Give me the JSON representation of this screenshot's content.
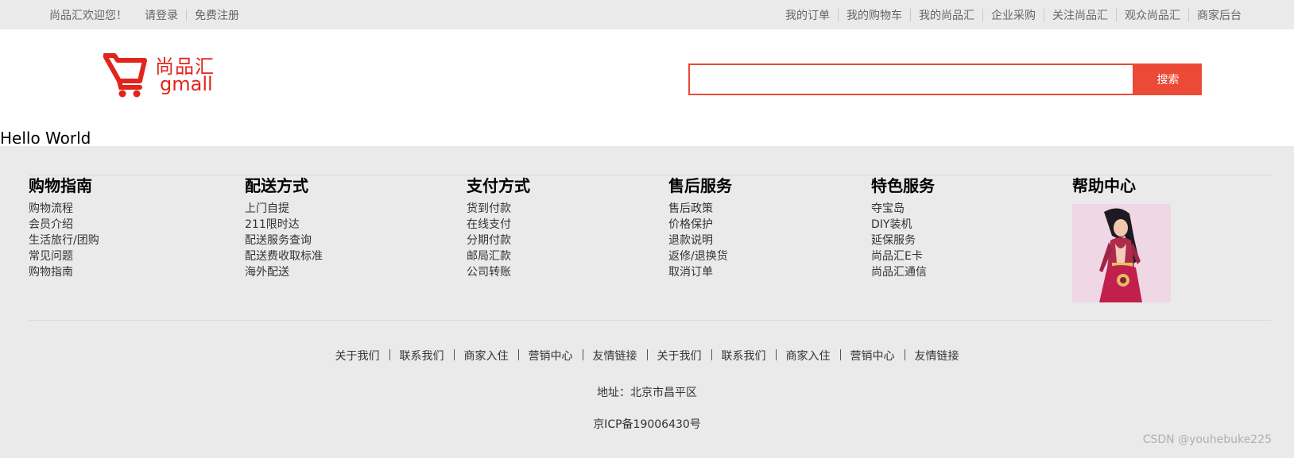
{
  "topbar": {
    "welcome": "尚品汇欢迎您！",
    "login": "请登录",
    "register": "免费注册",
    "nav": [
      "我的订单",
      "我的购物车",
      "我的尚品汇",
      "企业采购",
      "关注尚品汇",
      "观众尚品汇",
      "商家后台"
    ]
  },
  "header": {
    "logo_cn": "尚品汇",
    "logo_en": "gmall",
    "search_value": "",
    "search_button": "搜索",
    "accent": "#ea4a36"
  },
  "main": {
    "hello": "Hello World"
  },
  "footer": {
    "columns": [
      {
        "title": "购物指南",
        "items": [
          "购物流程",
          "会员介绍",
          "生活旅行/团购",
          "常见问题",
          "购物指南"
        ]
      },
      {
        "title": "配送方式",
        "items": [
          "上门自提",
          "211限时达",
          "配送服务查询",
          "配送费收取标准",
          "海外配送"
        ]
      },
      {
        "title": "支付方式",
        "items": [
          "货到付款",
          "在线支付",
          "分期付款",
          "邮局汇款",
          "公司转账"
        ]
      },
      {
        "title": "售后服务",
        "items": [
          "售后政策",
          "价格保护",
          "退款说明",
          "返修/退换货",
          "取消订单"
        ]
      },
      {
        "title": "特色服务",
        "items": [
          "夺宝岛",
          "DIY装机",
          "延保服务",
          "尚品汇E卡",
          "尚品汇通信"
        ]
      },
      {
        "title": "帮助中心",
        "items": []
      }
    ],
    "links": [
      "关于我们",
      "联系我们",
      "商家入住",
      "营销中心",
      "友情链接",
      "关于我们",
      "联系我们",
      "商家入住",
      "营销中心",
      "友情链接"
    ],
    "address": "地址：北京市昌平区",
    "icp": "京ICP备19006430号",
    "background": "#eaeaea"
  },
  "watermark": "CSDN @youhebuke225"
}
